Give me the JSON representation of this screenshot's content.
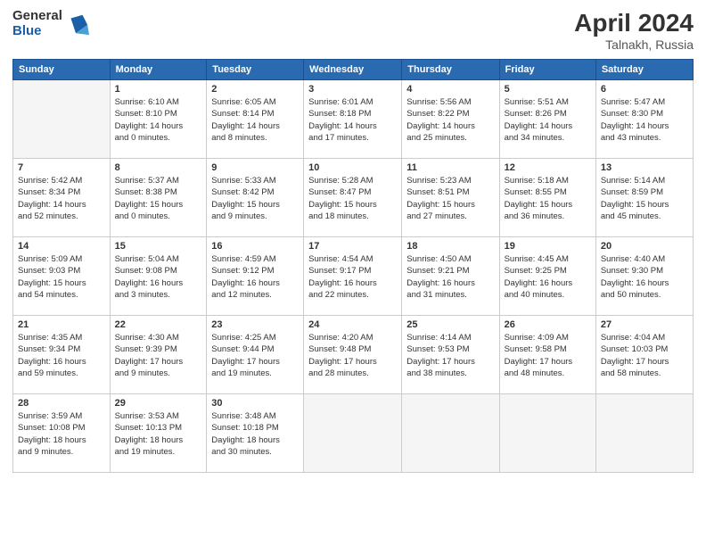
{
  "logo": {
    "general": "General",
    "blue": "Blue"
  },
  "header": {
    "title": "April 2024",
    "subtitle": "Talnakh, Russia"
  },
  "weekdays": [
    "Sunday",
    "Monday",
    "Tuesday",
    "Wednesday",
    "Thursday",
    "Friday",
    "Saturday"
  ],
  "weeks": [
    [
      {
        "day": "",
        "info": ""
      },
      {
        "day": "1",
        "info": "Sunrise: 6:10 AM\nSunset: 8:10 PM\nDaylight: 14 hours\nand 0 minutes."
      },
      {
        "day": "2",
        "info": "Sunrise: 6:05 AM\nSunset: 8:14 PM\nDaylight: 14 hours\nand 8 minutes."
      },
      {
        "day": "3",
        "info": "Sunrise: 6:01 AM\nSunset: 8:18 PM\nDaylight: 14 hours\nand 17 minutes."
      },
      {
        "day": "4",
        "info": "Sunrise: 5:56 AM\nSunset: 8:22 PM\nDaylight: 14 hours\nand 25 minutes."
      },
      {
        "day": "5",
        "info": "Sunrise: 5:51 AM\nSunset: 8:26 PM\nDaylight: 14 hours\nand 34 minutes."
      },
      {
        "day": "6",
        "info": "Sunrise: 5:47 AM\nSunset: 8:30 PM\nDaylight: 14 hours\nand 43 minutes."
      }
    ],
    [
      {
        "day": "7",
        "info": "Sunrise: 5:42 AM\nSunset: 8:34 PM\nDaylight: 14 hours\nand 52 minutes."
      },
      {
        "day": "8",
        "info": "Sunrise: 5:37 AM\nSunset: 8:38 PM\nDaylight: 15 hours\nand 0 minutes."
      },
      {
        "day": "9",
        "info": "Sunrise: 5:33 AM\nSunset: 8:42 PM\nDaylight: 15 hours\nand 9 minutes."
      },
      {
        "day": "10",
        "info": "Sunrise: 5:28 AM\nSunset: 8:47 PM\nDaylight: 15 hours\nand 18 minutes."
      },
      {
        "day": "11",
        "info": "Sunrise: 5:23 AM\nSunset: 8:51 PM\nDaylight: 15 hours\nand 27 minutes."
      },
      {
        "day": "12",
        "info": "Sunrise: 5:18 AM\nSunset: 8:55 PM\nDaylight: 15 hours\nand 36 minutes."
      },
      {
        "day": "13",
        "info": "Sunrise: 5:14 AM\nSunset: 8:59 PM\nDaylight: 15 hours\nand 45 minutes."
      }
    ],
    [
      {
        "day": "14",
        "info": "Sunrise: 5:09 AM\nSunset: 9:03 PM\nDaylight: 15 hours\nand 54 minutes."
      },
      {
        "day": "15",
        "info": "Sunrise: 5:04 AM\nSunset: 9:08 PM\nDaylight: 16 hours\nand 3 minutes."
      },
      {
        "day": "16",
        "info": "Sunrise: 4:59 AM\nSunset: 9:12 PM\nDaylight: 16 hours\nand 12 minutes."
      },
      {
        "day": "17",
        "info": "Sunrise: 4:54 AM\nSunset: 9:17 PM\nDaylight: 16 hours\nand 22 minutes."
      },
      {
        "day": "18",
        "info": "Sunrise: 4:50 AM\nSunset: 9:21 PM\nDaylight: 16 hours\nand 31 minutes."
      },
      {
        "day": "19",
        "info": "Sunrise: 4:45 AM\nSunset: 9:25 PM\nDaylight: 16 hours\nand 40 minutes."
      },
      {
        "day": "20",
        "info": "Sunrise: 4:40 AM\nSunset: 9:30 PM\nDaylight: 16 hours\nand 50 minutes."
      }
    ],
    [
      {
        "day": "21",
        "info": "Sunrise: 4:35 AM\nSunset: 9:34 PM\nDaylight: 16 hours\nand 59 minutes."
      },
      {
        "day": "22",
        "info": "Sunrise: 4:30 AM\nSunset: 9:39 PM\nDaylight: 17 hours\nand 9 minutes."
      },
      {
        "day": "23",
        "info": "Sunrise: 4:25 AM\nSunset: 9:44 PM\nDaylight: 17 hours\nand 19 minutes."
      },
      {
        "day": "24",
        "info": "Sunrise: 4:20 AM\nSunset: 9:48 PM\nDaylight: 17 hours\nand 28 minutes."
      },
      {
        "day": "25",
        "info": "Sunrise: 4:14 AM\nSunset: 9:53 PM\nDaylight: 17 hours\nand 38 minutes."
      },
      {
        "day": "26",
        "info": "Sunrise: 4:09 AM\nSunset: 9:58 PM\nDaylight: 17 hours\nand 48 minutes."
      },
      {
        "day": "27",
        "info": "Sunrise: 4:04 AM\nSunset: 10:03 PM\nDaylight: 17 hours\nand 58 minutes."
      }
    ],
    [
      {
        "day": "28",
        "info": "Sunrise: 3:59 AM\nSunset: 10:08 PM\nDaylight: 18 hours\nand 9 minutes."
      },
      {
        "day": "29",
        "info": "Sunrise: 3:53 AM\nSunset: 10:13 PM\nDaylight: 18 hours\nand 19 minutes."
      },
      {
        "day": "30",
        "info": "Sunrise: 3:48 AM\nSunset: 10:18 PM\nDaylight: 18 hours\nand 30 minutes."
      },
      {
        "day": "",
        "info": ""
      },
      {
        "day": "",
        "info": ""
      },
      {
        "day": "",
        "info": ""
      },
      {
        "day": "",
        "info": ""
      }
    ]
  ]
}
